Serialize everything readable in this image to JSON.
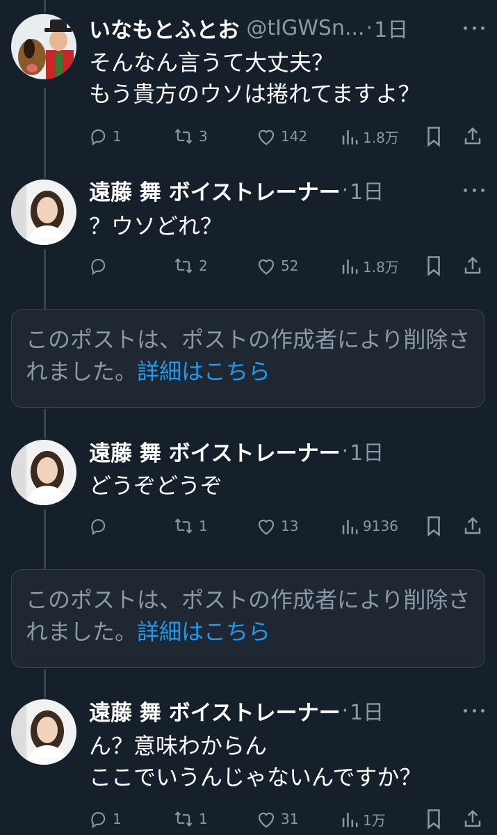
{
  "posts": [
    {
      "author": "いなもとふとお",
      "handle": "@tIGWSn...",
      "time": "1日",
      "text": "そんなん言うて大丈夫？\nもう貴方のウソは捲れてますよ？",
      "replies": "1",
      "reposts": "3",
      "likes": "142",
      "views": "1.8万"
    },
    {
      "author": "遠藤 舞 ボイストレーナー",
      "time": "1日",
      "text": "？ウソどれ？",
      "replies": "",
      "reposts": "2",
      "likes": "52",
      "views": "1.8万"
    },
    {
      "author": "遠藤 舞 ボイストレーナー",
      "time": "1日",
      "text": "どうぞどうぞ",
      "replies": "",
      "reposts": "1",
      "likes": "13",
      "views": "9136"
    },
    {
      "author": "遠藤 舞 ボイストレーナー",
      "time": "1日",
      "text": "ん？意味わからん\nここでいうんじゃないんですか？",
      "replies": "1",
      "reposts": "1",
      "likes": "31",
      "views": "1万"
    }
  ],
  "deleted_notice": {
    "text": "このポストは、ポストの作成者により削除されました。",
    "link": "詳細はこちら"
  },
  "icons": {
    "reply": "reply-icon",
    "repost": "repost-icon",
    "like": "heart-icon",
    "views": "views-icon",
    "bookmark": "bookmark-icon",
    "share": "share-icon",
    "more": "more-icon"
  },
  "colors": {
    "background": "#15202b",
    "secondary_text": "#8b98a5",
    "link": "#1d9bf0",
    "thread_line": "#38444d"
  }
}
